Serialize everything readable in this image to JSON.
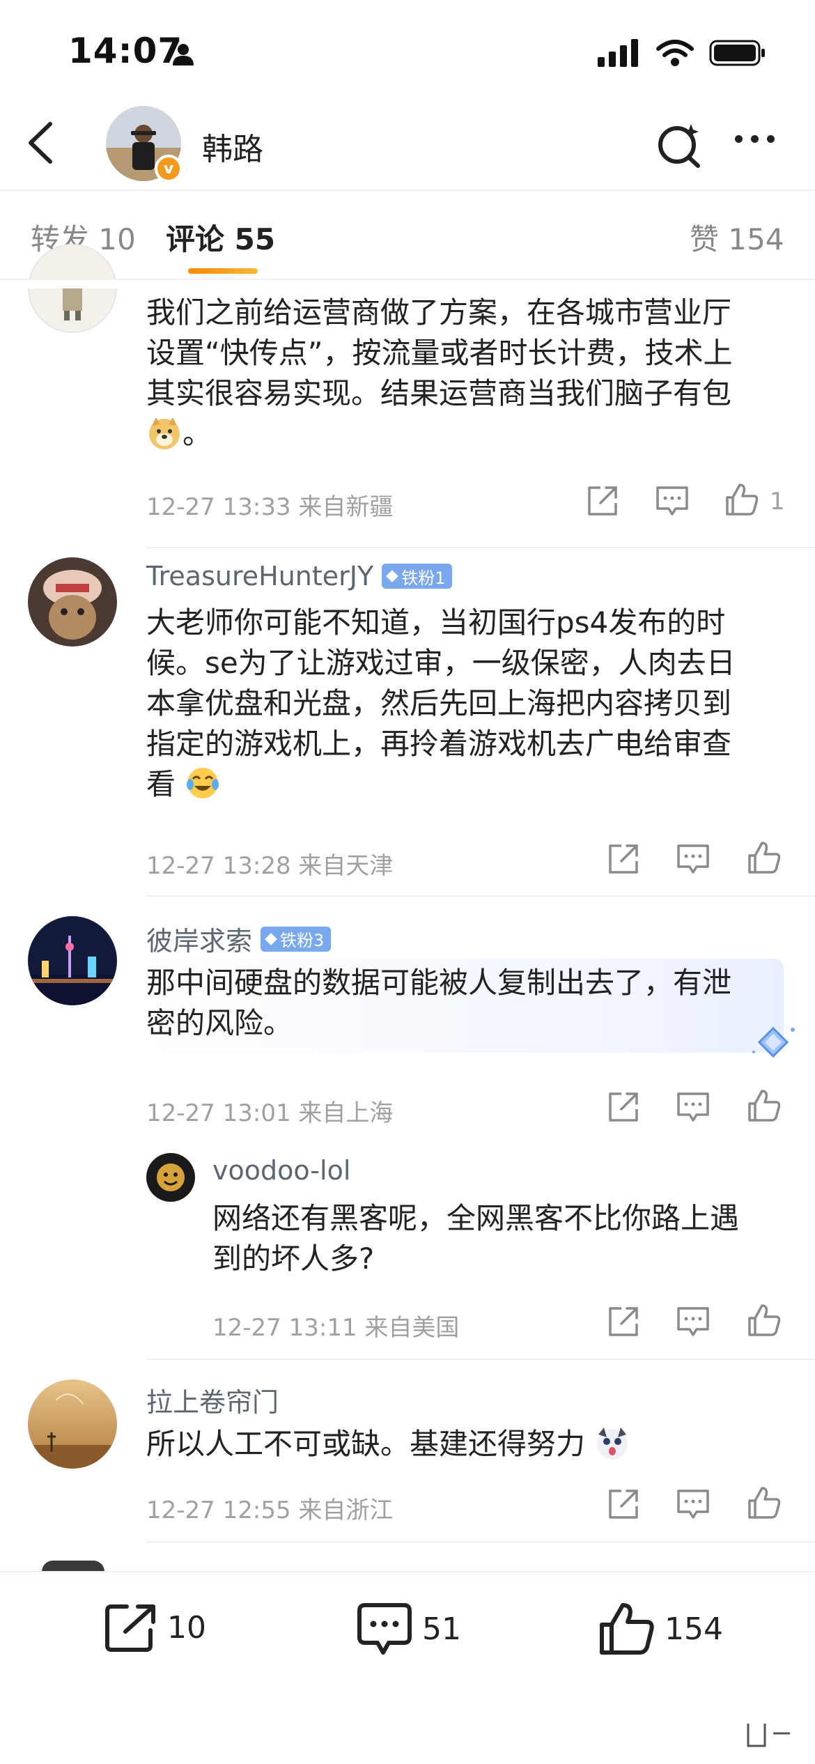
{
  "status_bar": {
    "time": "14:07"
  },
  "header": {
    "user_name": "韩路",
    "badge": "v"
  },
  "tabs": [
    {
      "label": "转发 10"
    },
    {
      "label": "评论 55"
    },
    {
      "label": "赞 154"
    }
  ],
  "comments": [
    {
      "text_lines": [
        "我们之前给运营商做了方案，在各城市营业厅",
        "设置“快传点”，按流量或者时长计费，技术上",
        "其实很容易实现。结果运营商当我们脑子有包",
        "。"
      ],
      "meta": "12-27 13:33 来自新疆",
      "likes": "1"
    },
    {
      "name": "TreasureHunterJY",
      "badge": "铁粉1",
      "text_lines": [
        "大老师你可能不知道，当初国行ps4发布的时",
        "候。se为了让游戏过审，一级保密，人肉去日",
        "本拿优盘和光盘，然后先回上海把内容拷贝到",
        "指定的游戏机上，再拎着游戏机去广电给审查",
        "看"
      ],
      "meta": "12-27 13:28 来自天津"
    },
    {
      "name": "彼岸求索",
      "badge": "铁粉3",
      "text_lines": [
        "那中间硬盘的数据可能被人复制出去了，有泄",
        "密的风险。"
      ],
      "meta": "12-27 13:01 来自上海"
    },
    {
      "name": "voodoo-lol",
      "text_lines": [
        "网络还有黑客呢，全网黑客不比你路上遇",
        "到的坏人多?"
      ],
      "meta": "12-27 13:11 来自美国"
    },
    {
      "name": "拉上卷帘门",
      "text_lines": [
        "所以人工不可或缺。基建还得努力"
      ],
      "meta": "12-27 12:55 来自浙江"
    }
  ],
  "bottom_bar": {
    "repost_count": "10",
    "comment_count": "51",
    "like_count": "154"
  },
  "colors": {
    "accent": "#ff8a00",
    "fan_badge": "#7aa8ef",
    "vip_badge": "#f39a1e"
  }
}
